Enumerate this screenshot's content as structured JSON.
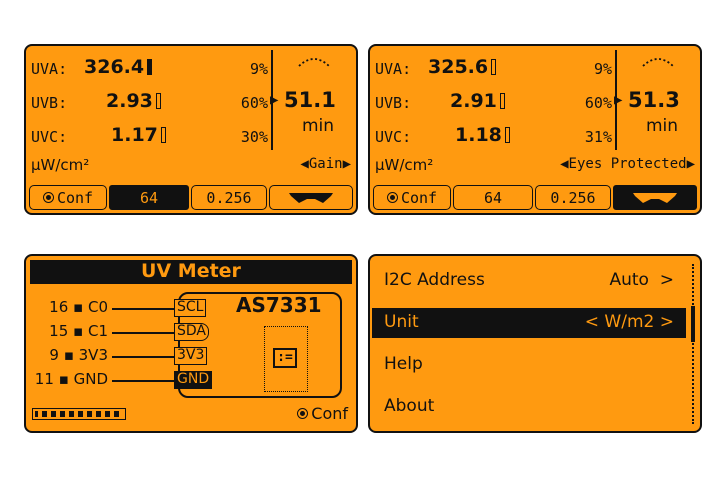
{
  "screens": [
    {
      "uva": {
        "label": "UVA:",
        "value": "326.4",
        "pct": "9%"
      },
      "uvb": {
        "label": "UVB:",
        "value": "2.93",
        "pct": "60%"
      },
      "uvc": {
        "label": "UVC:",
        "value": "1.17",
        "pct": "30%"
      },
      "time_value": "51.1",
      "time_unit": "min",
      "units": "µW/cm²",
      "selector": "Gain",
      "tabs": {
        "conf": "Conf",
        "gain": "64",
        "integration": "0.256"
      }
    },
    {
      "uva": {
        "label": "UVA:",
        "value": "325.6",
        "pct": "9%"
      },
      "uvb": {
        "label": "UVB:",
        "value": "2.91",
        "pct": "60%"
      },
      "uvc": {
        "label": "UVC:",
        "value": "1.18",
        "pct": "31%"
      },
      "time_value": "51.3",
      "time_unit": "min",
      "units": "µW/cm²",
      "selector": "Eyes Protected",
      "tabs": {
        "conf": "Conf",
        "gain": "64",
        "integration": "0.256"
      }
    }
  ],
  "wiring": {
    "title": "UV Meter",
    "chip": "AS7331",
    "pins": [
      {
        "board": "16",
        "gpio": "C0",
        "signal": "SCL"
      },
      {
        "board": "15",
        "gpio": "C1",
        "signal": "SDA"
      },
      {
        "board": "9",
        "gpio": "3V3",
        "signal": "3V3"
      },
      {
        "board": "11",
        "gpio": "GND",
        "signal": "GND"
      }
    ],
    "conf": "Conf"
  },
  "settings": {
    "items": [
      {
        "label": "I2C Address",
        "value": "Auto",
        "arrow_right": ">"
      },
      {
        "label": "Unit",
        "value": "W/m2",
        "arrow_left": "<",
        "arrow_right": ">"
      },
      {
        "label": "Help"
      },
      {
        "label": "About"
      }
    ]
  }
}
